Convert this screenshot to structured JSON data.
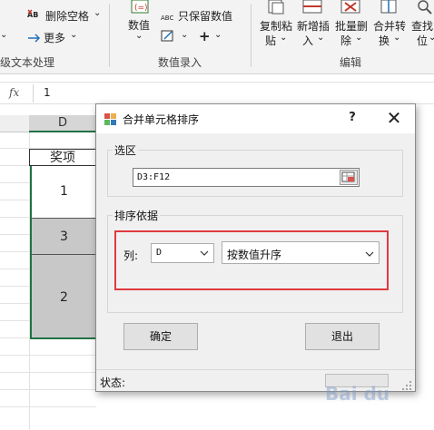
{
  "ribbon": {
    "delete_spaces": "删除空格",
    "more": "更多",
    "text_group_label": "级文本处理",
    "value": "数值",
    "keep_values": "只保留数值",
    "data_entry_label": "数值录入",
    "copy_paste_1": "复制粘",
    "copy_paste_2": "贴",
    "insert_1": "新增插",
    "insert_2": "入",
    "batch_delete_1": "批量删",
    "batch_delete_2": "除",
    "merge_convert_1": "合并转",
    "merge_convert_2": "换",
    "find_1": "查找",
    "find_2": "位",
    "edit_group_label": "编辑",
    "ab_prefix": "AB",
    "abc_prefix": "ABC"
  },
  "formula_bar": {
    "fx": "fx",
    "value": "1"
  },
  "sheet": {
    "col_d": "D",
    "header_cell": "奖项",
    "cells": [
      "1",
      "3",
      "2"
    ]
  },
  "dialog": {
    "title": "合并单元格排序",
    "help": "?",
    "close": "✕",
    "selection_label": "选区",
    "range_value": "D3:F12",
    "sort_basis_label": "排序依据",
    "column_label": "列:",
    "column_value": "D",
    "order_value": "按数值升序",
    "ok_button": "确定",
    "exit_button": "退出",
    "status_label": "状态:"
  },
  "watermark": "Bai du",
  "colors": {
    "accent_red": "#e0393e",
    "selected_cell": "#c8c8c8",
    "selection_border": "#217346"
  }
}
